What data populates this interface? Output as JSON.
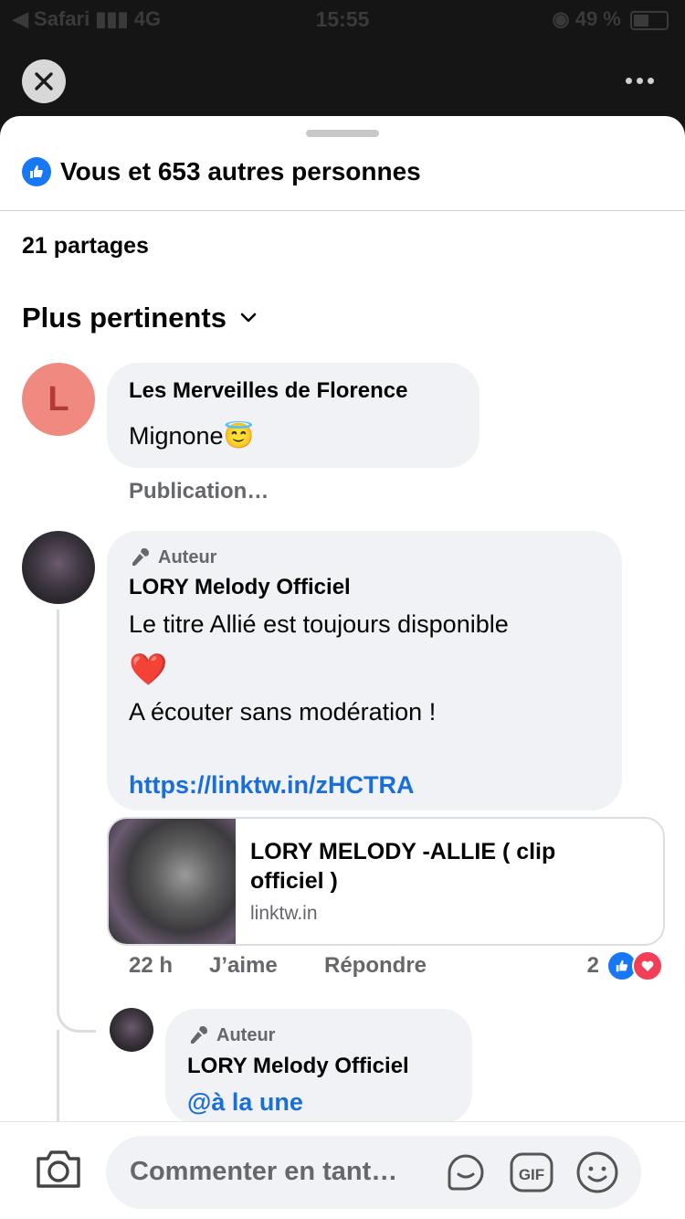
{
  "status_bar": {
    "carrier": "◀ Safari",
    "network": "4G",
    "time": "15:55",
    "battery": "49 %"
  },
  "reactions_summary": {
    "text": "Vous et 653 autres personnes"
  },
  "shares": {
    "text": "21 partages"
  },
  "sort": {
    "label": "Plus pertinents"
  },
  "comments": [
    {
      "avatar_letter": "L",
      "author": "Les Merveilles de Florence",
      "text": "Mignone😇",
      "status": "Publication…"
    },
    {
      "badge": "Auteur",
      "author": "LORY Melody Officiel",
      "line1": "Le titre Allié est toujours disponible",
      "emoji": "❤️",
      "line2": "A écouter sans modération !",
      "link": "https://linktw.in/zHCTRA",
      "link_preview": {
        "title": "LORY MELODY -ALLIE ( clip officiel )",
        "domain": "linktw.in"
      },
      "time": "22 h",
      "like_label": "J’aime",
      "reply_label": "Répondre",
      "reaction_count": "2"
    },
    {
      "badge": "Auteur",
      "author": "LORY Melody Officiel",
      "text": "@à la une"
    }
  ],
  "composer": {
    "placeholder": "Commenter en tant…",
    "gif_label": "GIF"
  },
  "colors": {
    "accent": "#1877f2",
    "love": "#f33e58",
    "bubble": "#f0f2f5",
    "link": "#1a6ed8"
  }
}
